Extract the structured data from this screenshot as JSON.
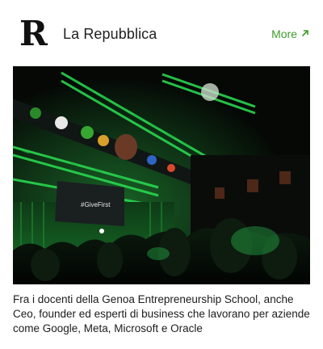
{
  "header": {
    "logo_letter": "R",
    "publisher": "La Repubblica",
    "more_label": "More"
  },
  "image": {
    "screen_text": "#GiveFirst"
  },
  "caption": "Fra i docenti della Genoa Entrepreneurship School, anche Ceo, founder ed esperti di business che lavorano per aziende come Google, Meta, Microsoft e Oracle",
  "colors": {
    "accent": "#3e9b2a",
    "stage_green": "#1fd04a"
  },
  "icons": {
    "more": "arrow-up-right-icon"
  }
}
